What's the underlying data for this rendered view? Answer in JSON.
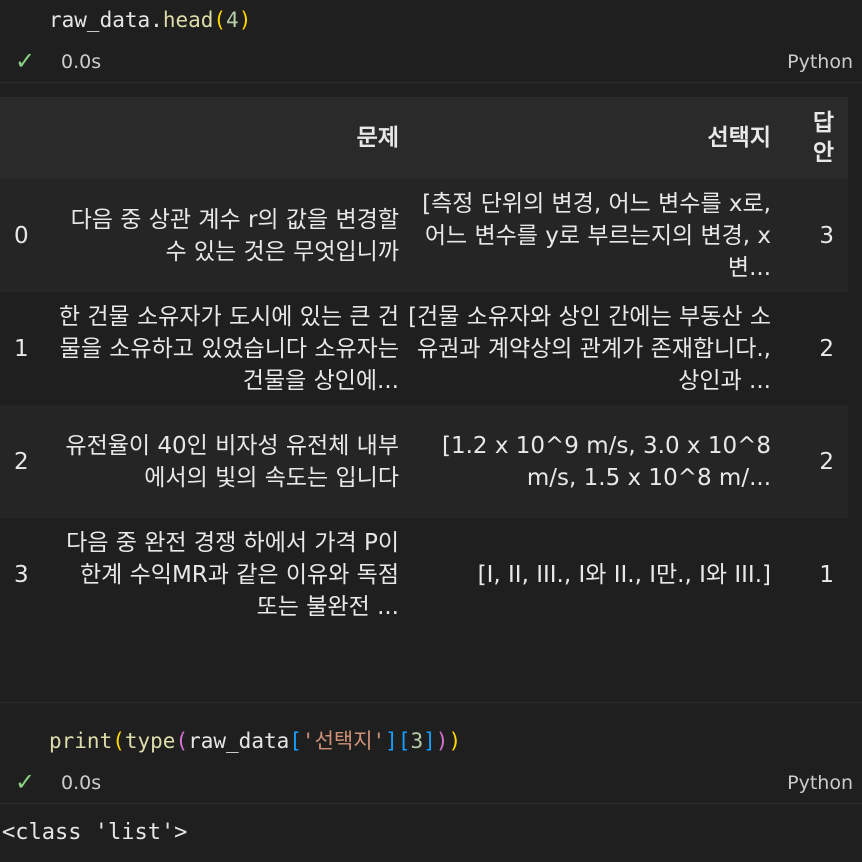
{
  "cell1": {
    "code": {
      "var": "raw_data",
      "dot": ".",
      "fn": "head",
      "open": "(",
      "arg": "4",
      "close": ")"
    },
    "status": {
      "check_icon": "check-icon",
      "time": "0.0s",
      "language": "Python"
    }
  },
  "table": {
    "headers": [
      "",
      "문제",
      "선택지",
      "답안"
    ],
    "header_answer_lines": [
      "답",
      "안"
    ],
    "rows": [
      {
        "index": "0",
        "question": "다음 중 상관 계수 r의 값을 변경할 수 있는 것은 무엇입니까",
        "choices": "[측정 단위의 변경, 어느 변수를 x로, 어느 변수를 y로 부르는지의 변경, x 변...",
        "answer": "3"
      },
      {
        "index": "1",
        "question": "한 건물 소유자가 도시에 있는 큰 건물을 소유하고 있었습니다 소유자는 건물을 상인에...",
        "choices": "[건물 소유자와 상인 간에는 부동산 소유권과 계약상의 관계가 존재합니다., 상인과 ...",
        "answer": "2"
      },
      {
        "index": "2",
        "question": "유전율이 40인 비자성 유전체 내부에서의 빛의 속도는 입니다",
        "choices": "[1.2 x 10^9 m/s, 3.0 x 10^8 m/s, 1.5 x 10^8 m/...",
        "answer": "2"
      },
      {
        "index": "3",
        "question": "다음 중 완전 경쟁 하에서 가격 P이 한계 수익MR과 같은 이유와 독점 또는 불완전 ...",
        "choices": "[I, II, III., I와 II., I만., I와 III.]",
        "answer": "1"
      }
    ]
  },
  "cell2": {
    "code": {
      "fn": "print",
      "p1": "(",
      "fn2": "type",
      "p2": "(",
      "var": "raw_data",
      "b1": "[",
      "str": "'선택지'",
      "b2": "]",
      "b3": "[",
      "num": "3",
      "b4": "]",
      "p2c": ")",
      "p1c": ")"
    },
    "status": {
      "check_icon": "check-icon",
      "time": "0.0s",
      "language": "Python"
    },
    "output": "<class 'list'>"
  }
}
